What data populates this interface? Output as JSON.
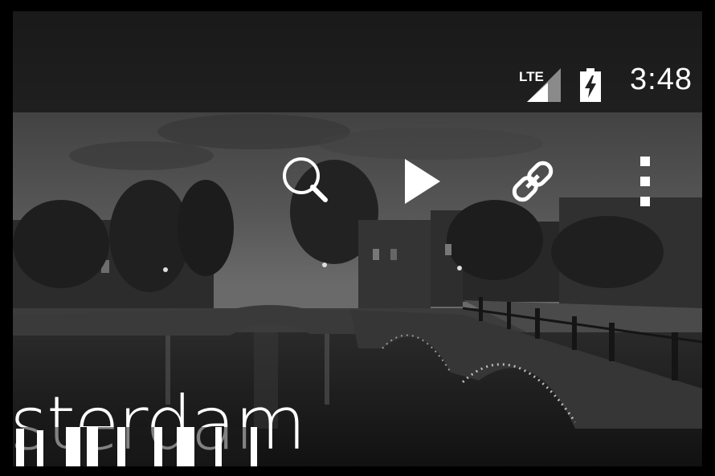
{
  "status_bar": {
    "network": "LTE",
    "time": "3:48"
  },
  "toolbar": {
    "actions": [
      "search-icon",
      "play-icon",
      "link-icon",
      "overflow-menu-icon"
    ]
  },
  "header": {
    "title": "sterdam"
  },
  "colors": {
    "status_bar_bg": "#121212",
    "icon": "#ffffff",
    "sky": "#4a4a4a",
    "water": "#1a1a1a"
  }
}
